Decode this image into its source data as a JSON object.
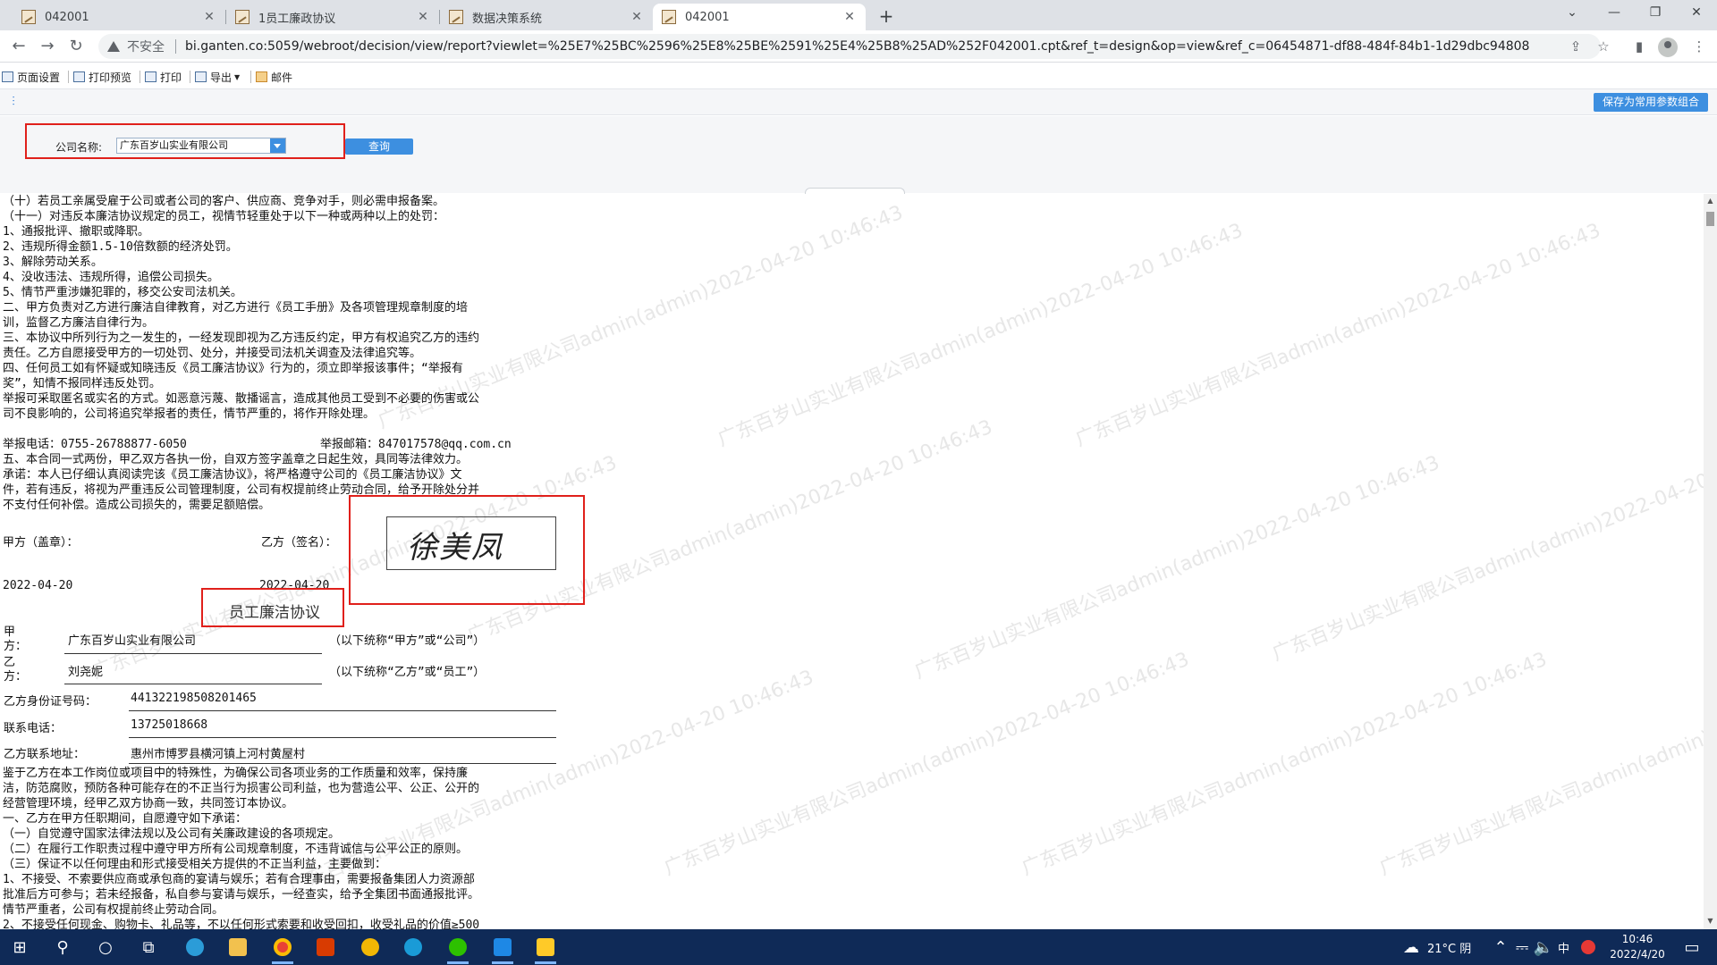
{
  "browser": {
    "tabs": [
      {
        "title": "042001",
        "active": false
      },
      {
        "title": "1员工廉政协议",
        "active": false
      },
      {
        "title": "数据决策系统",
        "active": false
      },
      {
        "title": "042001",
        "active": true
      }
    ],
    "security_label": "不安全",
    "url": "bi.ganten.co:5059/webroot/decision/view/report?viewlet=%25E7%25BC%2596%25E8%25BE%2591%25E4%25B8%25AD%252F042001.cpt&ref_t=design&op=view&ref_c=06454871-df88-484f-84b1-1d29dbc94808"
  },
  "report_toolbar": {
    "page_setup": "页面设置",
    "print_preview": "打印预览",
    "print": "打印",
    "export": "导出",
    "mail": "邮件"
  },
  "params": {
    "save_button": "保存为常用参数组合",
    "company_label": "公司名称:",
    "company_value": "广东百岁山实业有限公司",
    "query_button": "查询"
  },
  "content": {
    "upper_lines": [
      "（十）若员工亲属受雇于公司或者公司的客户、供应商、竞争对手，则必需申报备案。",
      "（十一）对违反本廉洁协议规定的员工，视情节轻重处于以下一种或两种以上的处罚：",
      "1、通报批评、撤职或降职。",
      "2、违规所得金额1.5-10倍数额的经济处罚。",
      "3、解除劳动关系。",
      "4、没收违法、违规所得，追偿公司损失。",
      "5、情节严重涉嫌犯罪的，移交公安司法机关。",
      "二、甲方负责对乙方进行廉洁自律教育，对乙方进行《员工手册》及各项管理规章制度的培",
      "训，监督乙方廉洁自律行为。",
      "三、本协议中所列行为之一发生的，一经发现即视为乙方违反约定，甲方有权追究乙方的违约",
      "责任。乙方自愿接受甲方的一切处罚、处分，并接受司法机关调查及法律追究等。",
      "四、任何员工如有怀疑或知晓违反《员工廉洁协议》行为的，须立即举报该事件；“举报有",
      "奖”，知情不报同样违反处罚。",
      "举报可采取匿名或实名的方式。如恶意污蔑、散播谣言，造成其他员工受到不必要的伤害或公",
      "司不良影响的，公司将追究举报者的责任，情节严重的，将作开除处理。"
    ],
    "report_phone": "举报电话：0755-26788877-6050",
    "report_email": "举报邮箱：847017578@qq.com.cn",
    "middle_lines": [
      "五、本合同一式两份，甲乙双方各执一份，自双方签字盖章之日起生效，具同等法律效力。",
      "承诺：本人已仔细认真阅读完该《员工廉洁协议》，将严格遵守公司的《员工廉洁协议》文",
      "件，若有违反，将视为严重违反公司管理制度，公司有权提前终止劳动合同，给予开除处分并",
      "不支付任何补偿。造成公司损失的，需要足额赔偿。"
    ],
    "party_a_seal": "甲方（盖章）：",
    "party_b_sign": "乙方（签名）：",
    "signature": "徐美凤",
    "date_a": "2022-04-20",
    "date_b": "2022-04-20",
    "contract_title": "员工廉洁协议",
    "party_a_label": "甲方：",
    "party_a_name": "广东百岁山实业有限公司",
    "party_a_note": "（以下统称“甲方”或“公司”）",
    "party_b_label": "乙方：",
    "party_b_name": "刘尧妮",
    "party_b_note": "（以下统称“乙方”或“员工”）",
    "id_label": "乙方身份证号码：",
    "id_value": "441322198508201465",
    "phone_label": "联系电话：",
    "phone_value": "13725018668",
    "address_label": "乙方联系地址：",
    "address_value": "惠州市博罗县横河镇上河村黄屋村",
    "lower_lines": [
      "鉴于乙方在本工作岗位或项目中的特殊性，为确保公司各项业务的工作质量和效率，保持廉",
      "洁，防范腐败，预防各种可能存在的不正当行为损害公司利益，也为营造公平、公正、公开的",
      "经营管理环境，经甲乙双方协商一致，共同签订本协议。",
      "一、乙方在甲方任职期间，自愿遵守如下承诺：",
      "（一）自觉遵守国家法律法规以及公司有关廉政建设的各项规定。",
      "（二）在履行工作职责过程中遵守甲方所有公司规章制度，不违背诚信与公平公正的原则。",
      "（三）保证不以任何理由和形式接受相关方提供的不正当利益，主要做到：",
      "1、不接受、不索要供应商或承包商的宴请与娱乐；若有合理事由，需要报备集团人力资源部",
      "批准后方可参与；若未经报备，私自参与宴请与娱乐，一经查实，给予全集团书面通报批评。",
      "情节严重者，公司有权提前终止劳动合同。",
      "2、不接受任何现金、购物卡、礼品等，不以任何形式索要和收受回扣，收受礼品的价值≥500"
    ],
    "watermark": "广东百岁山实业有限公司admin(admin)2022-04-20 10:46:43"
  },
  "taskbar": {
    "weather": "21°C 阴",
    "ime": "中",
    "time": "10:46",
    "date": "2022/4/20"
  }
}
